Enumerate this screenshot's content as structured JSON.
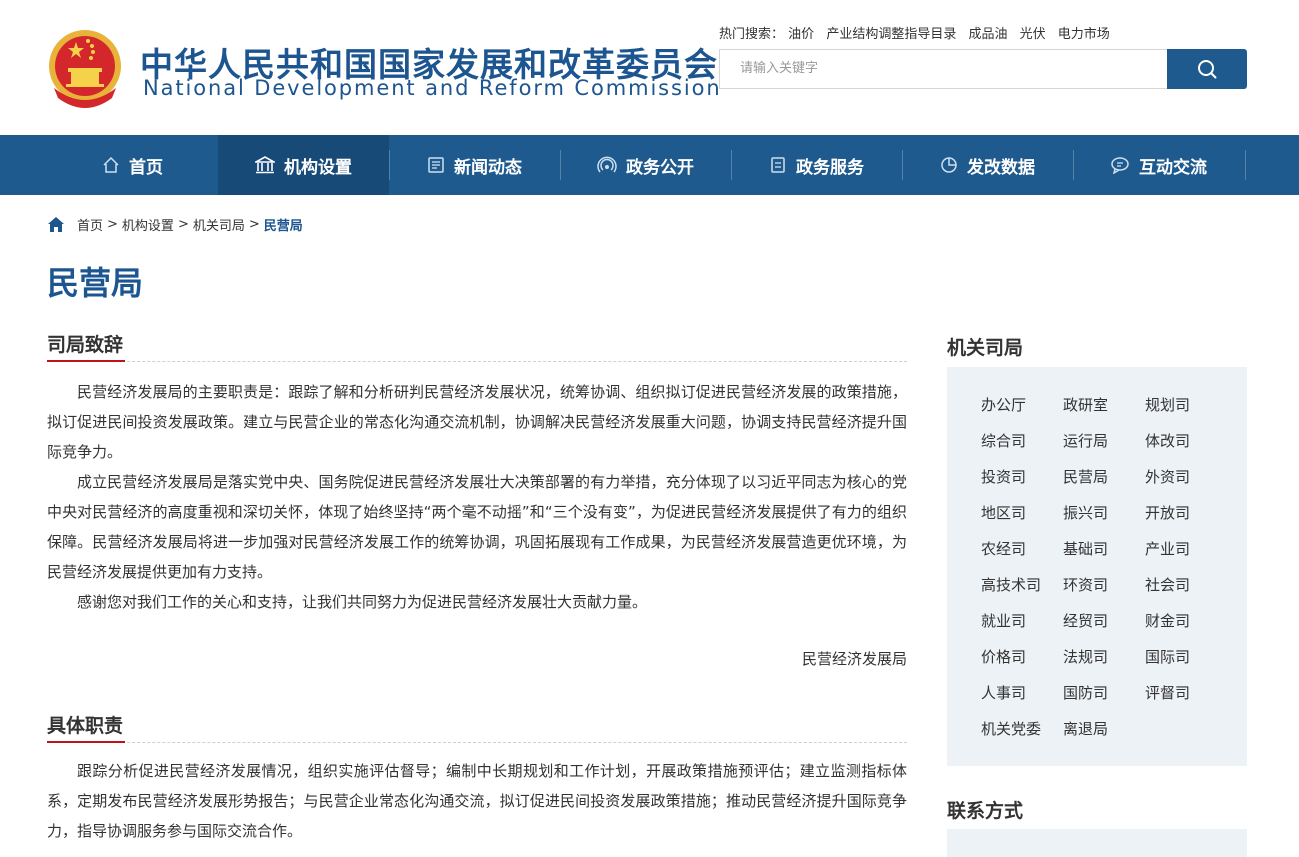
{
  "header": {
    "title_cn": "中华人民共和国国家发展和改革委员会",
    "title_en": "National Development and Reform Commission",
    "hot_label": "热门搜索：",
    "hot_terms": [
      "油价",
      "产业结构调整指导目录",
      "成品油",
      "光伏",
      "电力市场"
    ],
    "search_placeholder": "请输入关键字"
  },
  "nav": {
    "items": [
      {
        "label": "首页",
        "icon": "home-icon"
      },
      {
        "label": "机构设置",
        "icon": "institution-icon"
      },
      {
        "label": "新闻动态",
        "icon": "news-icon"
      },
      {
        "label": "政务公开",
        "icon": "broadcast-icon"
      },
      {
        "label": "政务服务",
        "icon": "service-icon"
      },
      {
        "label": "发改数据",
        "icon": "pie-chart-icon"
      },
      {
        "label": "互动交流",
        "icon": "chat-icon"
      }
    ],
    "active_index": 1
  },
  "breadcrumb": {
    "items": [
      "首页",
      "机构设置",
      "机关司局"
    ],
    "separator": ">",
    "current": "民营局"
  },
  "page_title": "民营局",
  "intro": {
    "heading": "司局致辞",
    "paragraphs": [
      "民营经济发展局的主要职责是：跟踪了解和分析研判民营经济发展状况，统筹协调、组织拟订促进民营经济发展的政策措施，拟订促进民间投资发展政策。建立与民营企业的常态化沟通交流机制，协调解决民营经济发展重大问题，协调支持民营经济提升国际竞争力。",
      "成立民营经济发展局是落实党中央、国务院促进民营经济发展壮大决策部署的有力举措，充分体现了以习近平同志为核心的党中央对民营经济的高度重视和深切关怀，体现了始终坚持“两个毫不动摇”和“三个没有变”，为促进民营经济发展提供了有力的组织保障。民营经济发展局将进一步加强对民营经济发展工作的统筹协调，巩固拓展现有工作成果，为民营经济发展营造更优环境，为民营经济发展提供更加有力支持。",
      "感谢您对我们工作的关心和支持，让我们共同努力为促进民营经济发展壮大贡献力量。"
    ],
    "signature": "民营经济发展局"
  },
  "duties": {
    "heading": "具体职责",
    "paragraph": "跟踪分析促进民营经济发展情况，组织实施评估督导；编制中长期规划和工作计划，开展政策措施预评估；建立监测指标体系，定期发布民营经济发展形势报告；与民营企业常态化沟通交流，拟订促进民间投资发展政策措施；推动民营经济提升国际竞争力，指导协调服务参与国际交流合作。"
  },
  "sidebar": {
    "departments_title": "机关司局",
    "departments": [
      "办公厅",
      "政研室",
      "规划司",
      "综合司",
      "运行局",
      "体改司",
      "投资司",
      "民营局",
      "外资司",
      "地区司",
      "振兴司",
      "开放司",
      "农经司",
      "基础司",
      "产业司",
      "高技术司",
      "环资司",
      "社会司",
      "就业司",
      "经贸司",
      "财金司",
      "价格司",
      "法规司",
      "国际司",
      "人事司",
      "国防司",
      "评督司",
      "机关党委",
      "离退局"
    ],
    "contact_title": "联系方式"
  },
  "colors": {
    "brand_blue": "#1c5590",
    "nav_bg": "#1e5a8e",
    "nav_active": "#174a77",
    "accent_red": "#c0121c",
    "sidebar_bg": "#edf2f6"
  }
}
